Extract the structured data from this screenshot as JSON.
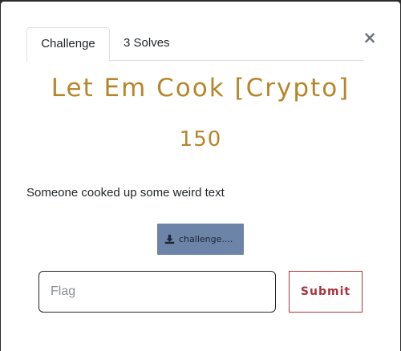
{
  "modal": {
    "close_label": "×",
    "tabs": [
      {
        "label": "Challenge",
        "active": true
      },
      {
        "label": "3 Solves",
        "active": false
      }
    ],
    "challenge": {
      "name": "Let Em Cook [Crypto]",
      "points": "150",
      "description": "Someone cooked up some weird text",
      "file_label": "challenge....",
      "file_icon": "download-icon"
    },
    "flag_input": {
      "placeholder": "Flag",
      "value": ""
    },
    "submit_label": "Submit"
  },
  "colors": {
    "accent": "#b5862a",
    "file_button": "#6b84a8",
    "submit": "#a9343c"
  }
}
